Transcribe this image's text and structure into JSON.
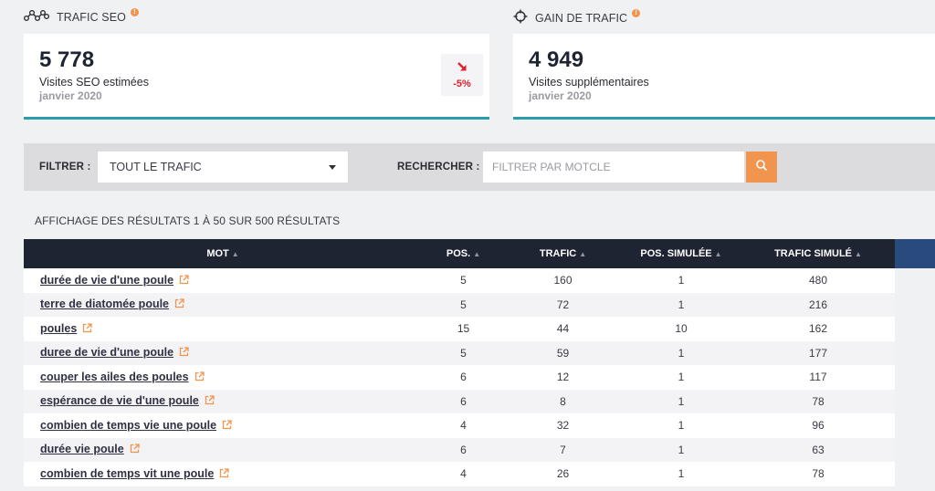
{
  "cards": [
    {
      "title": "TRAFIC SEO",
      "value": "5 778",
      "subtitle": "Visites SEO estimées",
      "date": "janvier 2020",
      "trend": "-5%"
    },
    {
      "title": "GAIN DE TRAFIC",
      "value": "4 949",
      "subtitle": "Visites supplémentaires",
      "date": "janvier 2020"
    }
  ],
  "filter": {
    "label": "FILTRER :",
    "selected": "TOUT LE TRAFIC",
    "search_label": "RECHERCHER :",
    "search_placeholder": "FILTRER PAR MOTCLE"
  },
  "results_info": "AFFICHAGE DES RÉSULTATS 1 À 50 SUR 500 RÉSULTATS",
  "table": {
    "headers": [
      "MOT",
      "POS.",
      "TRAFIC",
      "POS. SIMULÉE",
      "TRAFIC SIMULÉ"
    ],
    "rows": [
      [
        "durée de vie d'une poule",
        "5",
        "160",
        "1",
        "480"
      ],
      [
        "terre de diatomée poule",
        "5",
        "72",
        "1",
        "216"
      ],
      [
        "poules",
        "15",
        "44",
        "10",
        "162"
      ],
      [
        "duree de vie d'une poule",
        "5",
        "59",
        "1",
        "177"
      ],
      [
        "couper les ailes des poules",
        "6",
        "12",
        "1",
        "117"
      ],
      [
        "espérance de vie d'une poule",
        "6",
        "8",
        "1",
        "78"
      ],
      [
        "combien de temps vie une poule",
        "4",
        "32",
        "1",
        "96"
      ],
      [
        "durée vie poule",
        "6",
        "7",
        "1",
        "63"
      ],
      [
        "combien de temps vit une poule",
        "4",
        "26",
        "1",
        "78"
      ]
    ]
  },
  "colors": {
    "accent": "#f0944e",
    "teal": "#2a9da8",
    "header_bg": "#1f2433",
    "trend_down": "#e0202d"
  },
  "icons": {
    "card1": "graph-nodes-icon",
    "card2": "crosshair-icon",
    "search": "search-icon",
    "external": "external-link-icon"
  }
}
